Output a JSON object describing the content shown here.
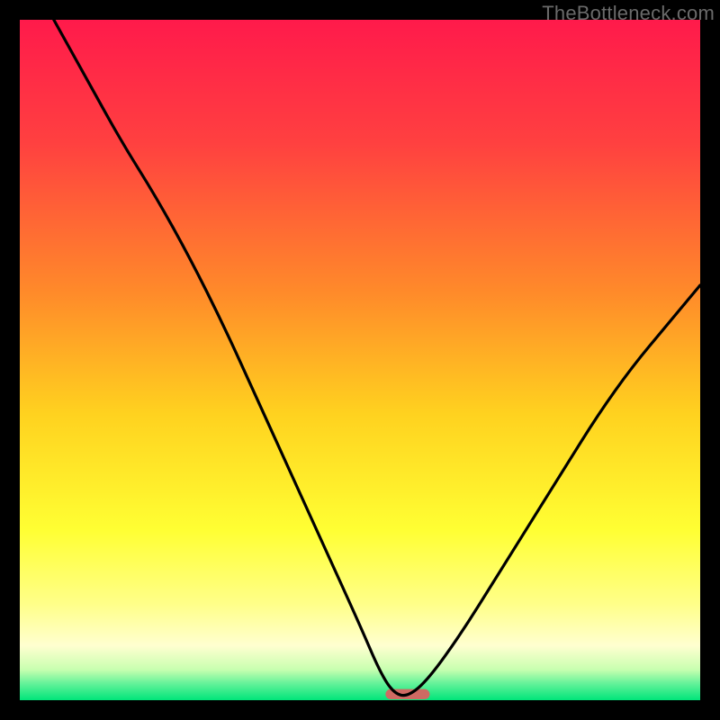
{
  "watermark": "TheBottleneck.com",
  "chart_data": {
    "type": "line",
    "title": "",
    "xlabel": "",
    "ylabel": "",
    "xlim": [
      0,
      100
    ],
    "ylim": [
      0,
      100
    ],
    "grid": false,
    "legend": false,
    "background_gradient_stops": [
      {
        "offset": 0.0,
        "color": "#ff1a4b"
      },
      {
        "offset": 0.18,
        "color": "#ff4040"
      },
      {
        "offset": 0.4,
        "color": "#ff8a2a"
      },
      {
        "offset": 0.58,
        "color": "#ffd21f"
      },
      {
        "offset": 0.75,
        "color": "#ffff33"
      },
      {
        "offset": 0.86,
        "color": "#ffff8a"
      },
      {
        "offset": 0.92,
        "color": "#ffffd0"
      },
      {
        "offset": 0.955,
        "color": "#c8ffb0"
      },
      {
        "offset": 0.975,
        "color": "#66f29a"
      },
      {
        "offset": 1.0,
        "color": "#00e57a"
      }
    ],
    "series": [
      {
        "name": "bottleneck-curve",
        "x": [
          5,
          10,
          15,
          20,
          25,
          30,
          35,
          40,
          45,
          50,
          53,
          55,
          57,
          60,
          65,
          70,
          75,
          80,
          85,
          90,
          95,
          100
        ],
        "y": [
          100,
          91,
          82,
          74,
          65,
          55,
          44,
          33,
          22,
          11,
          4,
          1,
          0.5,
          3,
          10,
          18,
          26,
          34,
          42,
          49,
          55,
          61
        ]
      }
    ],
    "marker": {
      "name": "optimal-marker",
      "x": 57,
      "width_pct": 6.5,
      "height_pct": 1.5,
      "color": "#cf6a63"
    }
  }
}
